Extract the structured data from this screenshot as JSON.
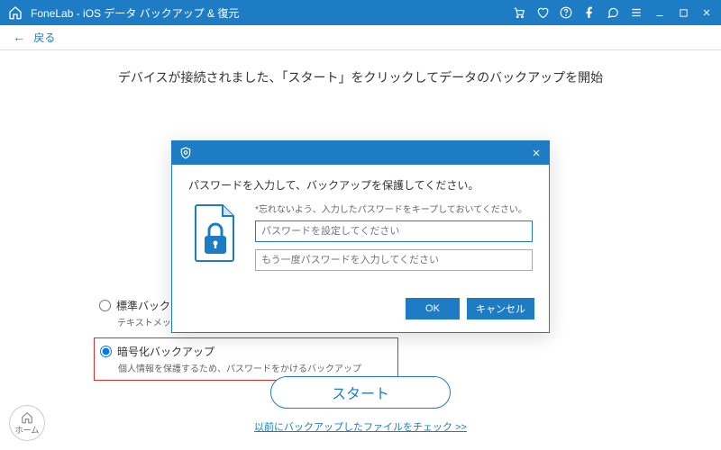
{
  "titlebar": {
    "app_title": "FoneLab - iOS データ バックアップ & 復元"
  },
  "backbar": {
    "label": "戻る"
  },
  "main": {
    "instruction": "デバイスが接続されました、「スタート」をクリックしてデータのバックアップを開始"
  },
  "radios": {
    "standard": {
      "title": "標準バックアップ",
      "desc": "テキストメッセージ、連絡先、通話履歴等のバックアップ"
    },
    "encrypted": {
      "title": "暗号化バックアップ",
      "desc": "個人情報を保護するため、パスワードをかけるバックアップ"
    }
  },
  "start_label": "スタート",
  "prev_link": "以前にバックアップしたファイルをチェック >>",
  "home_label": "ホーム",
  "modal": {
    "prompt": "パスワードを入力して、バックアップを保護してください。",
    "note": "*忘れないよう、入力したパスワードをキープしておいてください。",
    "placeholder1": "パスワードを設定してください",
    "placeholder2": "もう一度パスワードを入力してください",
    "ok": "OK",
    "cancel": "キャンセル"
  }
}
